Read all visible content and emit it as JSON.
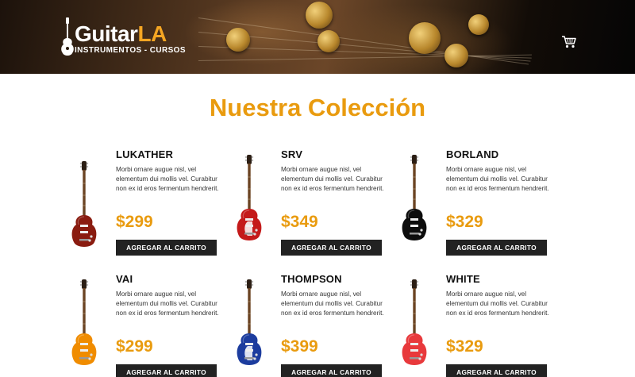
{
  "header": {
    "brand_primary": "Guitar",
    "brand_accent": "LA",
    "tagline": "INSTRUMENTOS - CURSOS",
    "cart_icon": "cart-icon",
    "accent_color": "#f5a623"
  },
  "main": {
    "title": "Nuestra Colección",
    "accent_color": "#e99b0f",
    "products": [
      {
        "name": "LUKATHER",
        "description": "Morbi ornare augue nisl, vel elementum dui mollis vel. Curabitur non ex id eros fermentum hendrerit.",
        "price": "$299",
        "button": "AGREGAR AL CARRITO",
        "guitar_body_color": "#8a1c10"
      },
      {
        "name": "SRV",
        "description": "Morbi ornare augue nisl, vel elementum dui mollis vel. Curabitur non ex id eros fermentum hendrerit.",
        "price": "$349",
        "button": "AGREGAR AL CARRITO",
        "guitar_body_color": "#c41a1a"
      },
      {
        "name": "BORLAND",
        "description": "Morbi ornare augue nisl, vel elementum dui mollis vel. Curabitur non ex id eros fermentum hendrerit.",
        "price": "$329",
        "button": "AGREGAR AL CARRITO",
        "guitar_body_color": "#0d0d0d"
      },
      {
        "name": "VAI",
        "description": "Morbi ornare augue nisl, vel elementum dui mollis vel. Curabitur non ex id eros fermentum hendrerit.",
        "price": "$299",
        "button": "AGREGAR AL CARRITO",
        "guitar_body_color": "#f08c00"
      },
      {
        "name": "THOMPSON",
        "description": "Morbi ornare augue nisl, vel elementum dui mollis vel. Curabitur non ex id eros fermentum hendrerit.",
        "price": "$399",
        "button": "AGREGAR AL CARRITO",
        "guitar_body_color": "#1c3c9e"
      },
      {
        "name": "WHITE",
        "description": "Morbi ornare augue nisl, vel elementum dui mollis vel. Curabitur non ex id eros fermentum hendrerit.",
        "price": "$329",
        "button": "AGREGAR AL CARRITO",
        "guitar_body_color": "#e8393c"
      }
    ]
  }
}
